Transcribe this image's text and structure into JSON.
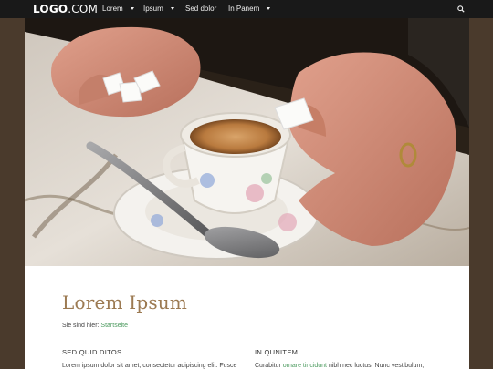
{
  "header": {
    "logo_bold": "LOGO",
    "logo_thin": ".COM",
    "nav": [
      {
        "label": "Lorem",
        "has_dropdown": true
      },
      {
        "label": "Ipsum",
        "has_dropdown": true
      },
      {
        "label": "Sed dolor",
        "has_dropdown": false
      },
      {
        "label": "In Panem",
        "has_dropdown": true
      }
    ],
    "search_icon": "search-icon"
  },
  "hero": {
    "image": "hands holding sugar cubes over espresso cup and saucer with spoon"
  },
  "main": {
    "title": "Lorem Ipsum",
    "breadcrumb_prefix": "Sie sind hier:",
    "breadcrumb_link": "Startseite",
    "columns": [
      {
        "heading": "SED QUID DITOS",
        "text": "Lorem ipsum dolor sit amet, consectetur adipiscing elit. Fusce"
      },
      {
        "heading": "IN QUNITEM",
        "text_before": "Curabitur",
        "link": "ornare tincidunt",
        "text_after": "nibh nec luctus. Nunc vestibulum,"
      }
    ]
  },
  "colors": {
    "background": "#4a3a2c",
    "topbar": "#191919",
    "title": "#9c7a52",
    "link": "#4b9a5e"
  }
}
